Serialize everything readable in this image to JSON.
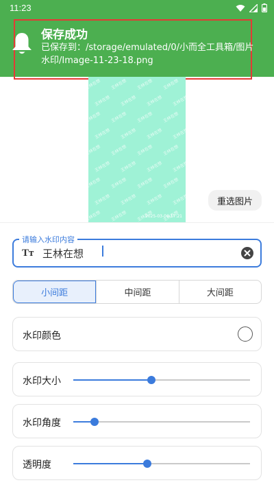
{
  "status_bar": {
    "time": "11:23"
  },
  "notification": {
    "title": "保存成功",
    "message": "已保存到：/storage/emulated/0/小而全工具箱/图片水印/Image-11-23-18.png"
  },
  "preview": {
    "watermark_text": "王林在想",
    "date_stamp": "2025-03-06 17:21"
  },
  "reselect_button": {
    "label": "重选图片"
  },
  "watermark_input": {
    "label": "请输入水印内容",
    "value": "王林在想"
  },
  "spacing_options": {
    "options": [
      "小间距",
      "中间距",
      "大间距"
    ],
    "selected": "小间距"
  },
  "settings": {
    "color_label": "水印颜色",
    "size_label": "水印大小",
    "size_value": 0.44,
    "angle_label": "水印角度",
    "angle_value": 0.12,
    "opacity_label": "透明度",
    "opacity_value": 0.42
  },
  "colors": {
    "notification_bg": "#4caf50",
    "accent": "#3b7bdc",
    "preview_bg": "#9ff2d6"
  }
}
